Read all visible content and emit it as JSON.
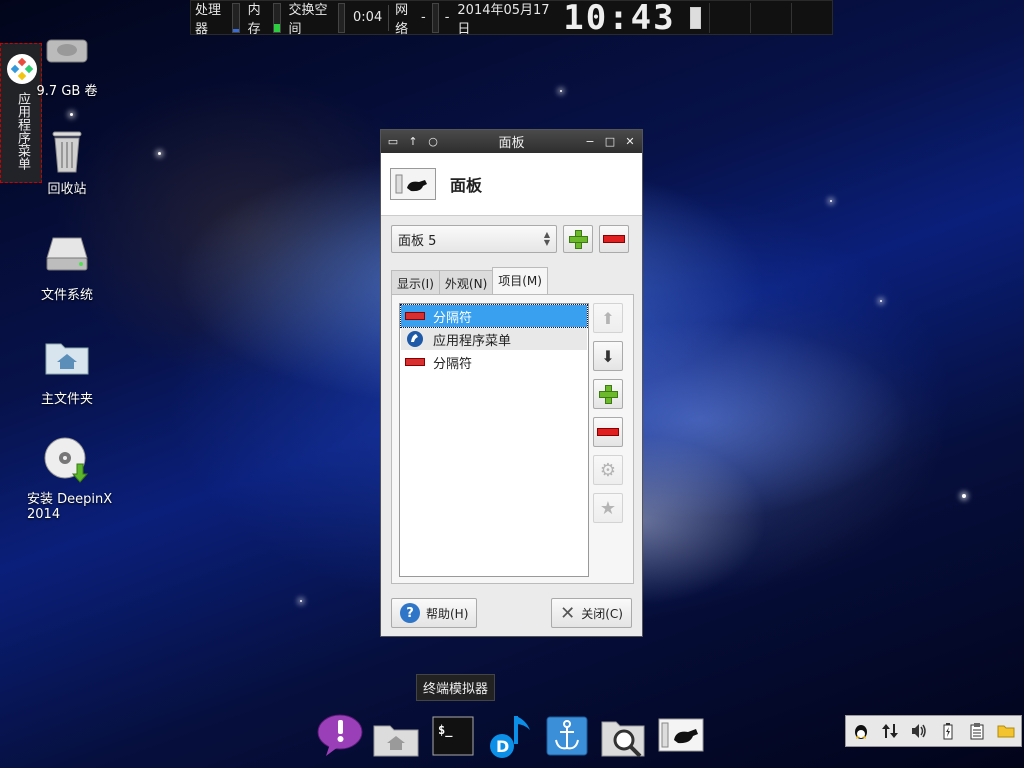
{
  "top_panel": {
    "cpu_label": "处理器",
    "mem_label": "内存",
    "swap_label": "交换空间",
    "uptime": "0:04",
    "net_label": "网络",
    "net_dash1": "-",
    "net_dash2": "-",
    "date": "2014年05月17日",
    "clock": "10:43"
  },
  "left_panel": {
    "label": "应用程序菜单"
  },
  "desktop": {
    "icons": [
      {
        "label": "9.7 GB 卷"
      },
      {
        "label": "回收站"
      },
      {
        "label": "文件系统"
      },
      {
        "label": "主文件夹"
      },
      {
        "label": "安装 DeepinX 2014"
      }
    ]
  },
  "dialog": {
    "title": "面板",
    "header_title": "面板",
    "panel_select": "面板 5",
    "tabs": [
      "显示(I)",
      "外观(N)",
      "项目(M)"
    ],
    "items": [
      {
        "label": "分隔符",
        "selected": true
      },
      {
        "label": "应用程序菜单",
        "selected": false
      },
      {
        "label": "分隔符",
        "selected": false
      }
    ],
    "help_label": "帮助(H)",
    "close_label": "关闭(C)"
  },
  "tooltip": "终端模拟器",
  "colors": {
    "accent": "#38a0ee",
    "add": "#6cba2c",
    "remove": "#e02020"
  }
}
